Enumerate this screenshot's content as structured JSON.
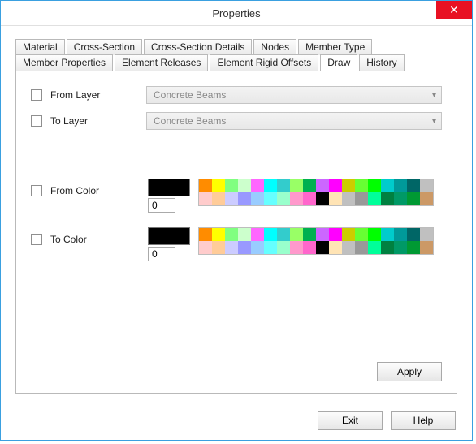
{
  "window": {
    "title": "Properties"
  },
  "tabs": {
    "row1": [
      "Material",
      "Cross-Section",
      "Cross-Section Details",
      "Nodes",
      "Member Type"
    ],
    "row2": [
      "Member Properties",
      "Element Releases",
      "Element Rigid Offsets",
      "Draw",
      "History"
    ],
    "active": "Draw"
  },
  "panel": {
    "fromLayer": {
      "label": "From Layer",
      "value": "Concrete Beams"
    },
    "toLayer": {
      "label": "To Layer",
      "value": "Concrete Beams"
    },
    "fromColor": {
      "label": "From Color",
      "index": "0",
      "swatch": "#000000"
    },
    "toColor": {
      "label": "To Color",
      "index": "0",
      "swatch": "#000000"
    },
    "palette": [
      "#ff8c00",
      "#ffff00",
      "#80ff80",
      "#ccffcc",
      "#ff66ff",
      "#00ffff",
      "#33cccc",
      "#99ff66",
      "#00b050",
      "#cc66ff",
      "#ff00ff",
      "#cccc00",
      "#66ff33",
      "#00ff00",
      "#00cccc",
      "#009999",
      "#006666",
      "#c0c0c0",
      "#ffcccc",
      "#ffcc99",
      "#ccccff",
      "#9999ff",
      "#99ccff",
      "#66ffff",
      "#99ffcc",
      "#ff99cc",
      "#ff66cc",
      "#000000",
      "#ffe4b5",
      "#c0c0c0",
      "#999999",
      "#00ff99",
      "#008040",
      "#009966",
      "#009933",
      "#cc9966"
    ],
    "apply": "Apply"
  },
  "footer": {
    "exit": "Exit",
    "help": "Help"
  }
}
